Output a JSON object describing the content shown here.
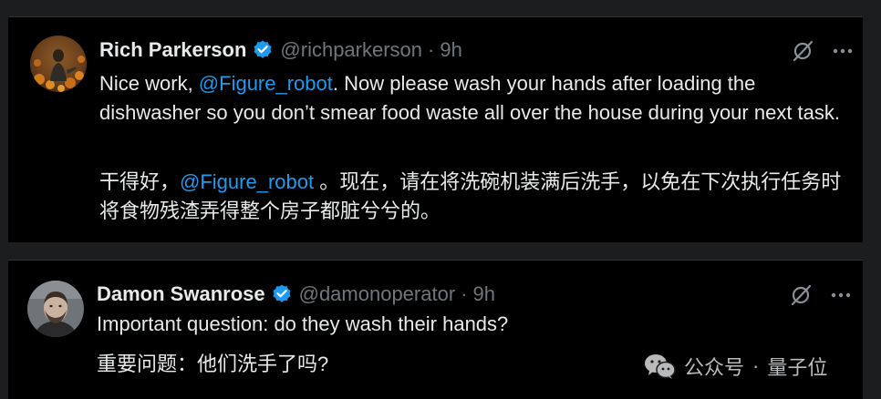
{
  "tweets": [
    {
      "display_name": "Rich Parkerson",
      "handle": "@richparkerson",
      "separator": "·",
      "time": "9h",
      "body_en": {
        "before": "Nice work, ",
        "mention": "@Figure_robot",
        "after": ".  Now please wash your hands after loading the dishwasher so you don’t smear food waste all over the house during your next task."
      },
      "body_zh": {
        "before": "干得好，",
        "mention": "@Figure_robot",
        "after": " 。现在，请在将洗碗机装满后洗手，以免在下次执行任务时将食物残渣弄得整个房子都脏兮兮的。"
      }
    },
    {
      "display_name": "Damon Swanrose",
      "handle": "@damonoperator",
      "separator": "·",
      "time": "9h",
      "body_en": "Important question: do they wash their hands?",
      "body_zh": "重要问题：他们洗手了吗?"
    }
  ],
  "watermark": {
    "name": "公众号",
    "separator": "·",
    "brand": "量子位"
  },
  "icons": {
    "verified": "verified-badge-icon",
    "grok": "grok-icon",
    "more": "more-icon",
    "wechat": "wechat-icon"
  },
  "colors": {
    "background": "#000000",
    "text": "#e7e9ea",
    "secondary": "#71767b",
    "mention": "#1d9bf0",
    "verified": "#1d9bf0"
  }
}
